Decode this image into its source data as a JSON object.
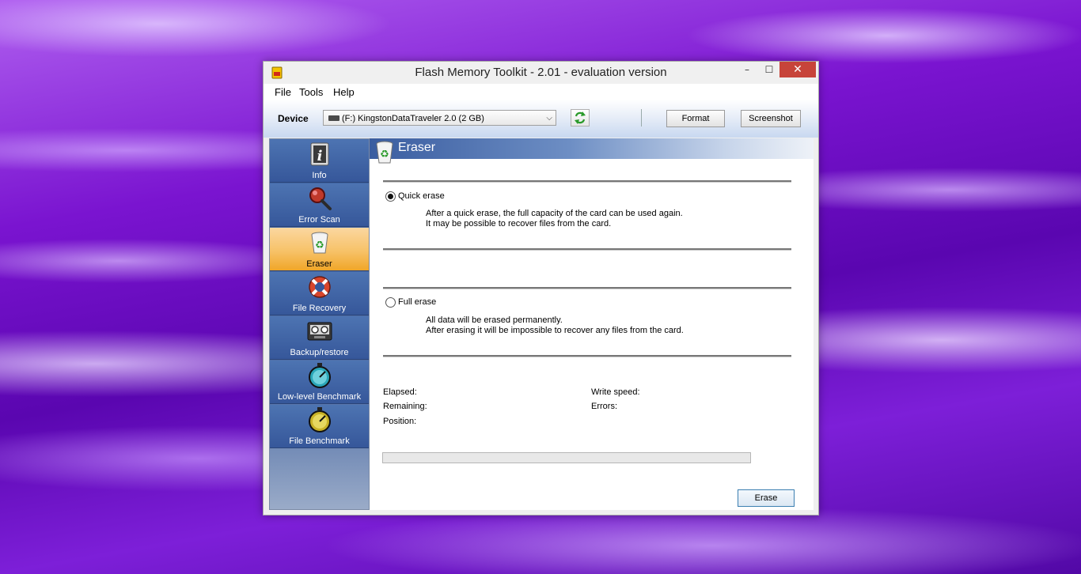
{
  "window": {
    "title": "Flash Memory Toolkit - 2.01 - evaluation version",
    "controls": {
      "minimize": "–",
      "maximize": "☐",
      "close": "✕"
    }
  },
  "menu": [
    "File",
    "Tools",
    "Help"
  ],
  "toolbar": {
    "device_label": "Device",
    "device_value": "(F:) KingstonDataTraveler 2.0 (2 GB)",
    "format_label": "Format",
    "screenshot_label": "Screenshot"
  },
  "sidebar": {
    "items": [
      {
        "label": "Info",
        "icon": "info-icon"
      },
      {
        "label": "Error Scan",
        "icon": "magnifier-icon"
      },
      {
        "label": "Eraser",
        "icon": "recycle-bin-icon",
        "active": true
      },
      {
        "label": "File Recovery",
        "icon": "lifebuoy-icon"
      },
      {
        "label": "Backup/restore",
        "icon": "tape-icon"
      },
      {
        "label": "Low-level Benchmark",
        "icon": "stopwatch-icon"
      },
      {
        "label": "File Benchmark",
        "icon": "stopwatch-icon"
      }
    ]
  },
  "panel": {
    "title": "Eraser",
    "quick_erase": {
      "label": "Quick erase",
      "selected": true,
      "line1": "After a quick erase, the full capacity of the card can be used again.",
      "line2": "It may be possible to recover files from the card."
    },
    "full_erase": {
      "label": "Full erase",
      "selected": false,
      "line1": "All data will be erased permanently.",
      "line2": "After erasing it will be impossible to recover any files from the card."
    },
    "stats": {
      "elapsed": "Elapsed:",
      "remaining": "Remaining:",
      "position": "Position:",
      "write_speed": "Write speed:",
      "errors": "Errors:"
    },
    "progress": 0,
    "erase_label": "Erase"
  }
}
